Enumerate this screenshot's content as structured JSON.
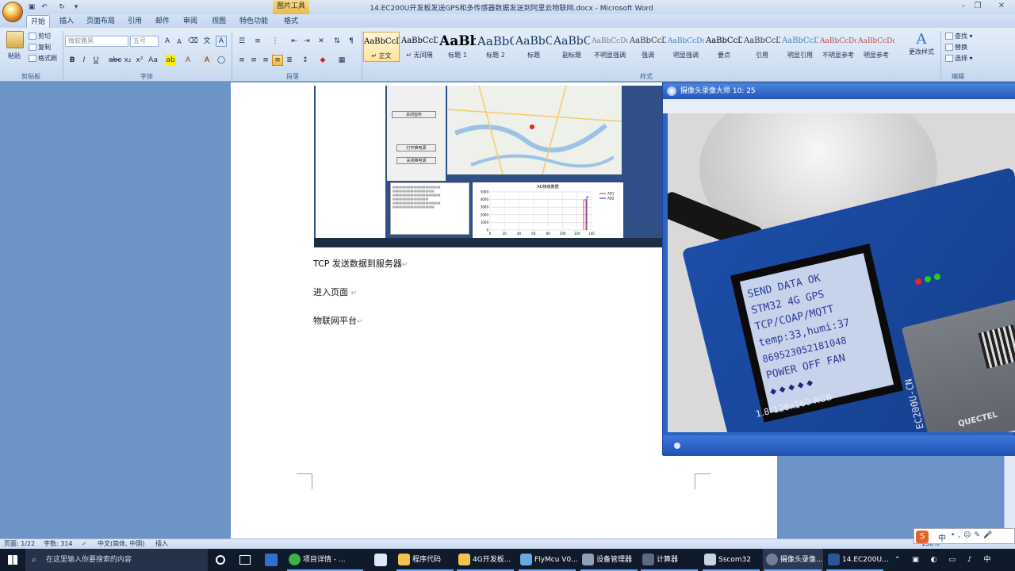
{
  "title_bar": {
    "contextual_tab": "图片工具",
    "window_title": "14.EC200U开发板发送GPS和多传感器数据发送到阿里云物联网.docx - Microsoft Word"
  },
  "tabs": [
    "开始",
    "插入",
    "页面布局",
    "引用",
    "邮件",
    "审阅",
    "视图",
    "特色功能",
    "格式"
  ],
  "ribbon": {
    "clipboard": {
      "paste": "粘贴",
      "cut": "剪切",
      "copy": "复制",
      "format_painter": "格式刷",
      "label": "剪贴板"
    },
    "font": {
      "name": "微软雅黑",
      "size": "五号",
      "label": "字体"
    },
    "paragraph": {
      "label": "段落"
    },
    "styles": {
      "label": "样式",
      "items": [
        {
          "preview": "AaBbCcDd",
          "name": "↵ 正文"
        },
        {
          "preview": "AaBbCcDd",
          "name": "↵ 无间隔"
        },
        {
          "preview": "AaBb",
          "name": "标题 1"
        },
        {
          "preview": "AaBbC",
          "name": "标题 2"
        },
        {
          "preview": "AaBbC",
          "name": "标题"
        },
        {
          "preview": "AaBbC",
          "name": "副标题"
        },
        {
          "preview": "AaBbCcDd",
          "name": "不明显强调"
        },
        {
          "preview": "AaBbCcDd",
          "name": "强调"
        },
        {
          "preview": "AaBbCcDd",
          "name": "明显强调"
        },
        {
          "preview": "AaBbCcDd",
          "name": "要点"
        },
        {
          "preview": "AaBbCcDd",
          "name": "引用"
        },
        {
          "preview": "AaBbCcDd",
          "name": "明显引用"
        },
        {
          "preview": "AaBbCcDd",
          "name": "不明显参考"
        },
        {
          "preview": "AaBbCcDd",
          "name": "明显参考"
        }
      ],
      "change_styles": "更改样式"
    },
    "editing": {
      "find": "查找",
      "replace": "替换",
      "select": "选择",
      "label": "编辑"
    }
  },
  "document": {
    "lines": [
      "TCP 发送数据到服务器",
      "进入页面",
      "物联网平台"
    ],
    "embedded": {
      "buttons": [
        "关闭监听",
        "打开推电源",
        "关闭推电源"
      ],
      "chart_title": "AD接收数据",
      "y_ticks": [
        "5000",
        "4000",
        "3000",
        "2000",
        "1000",
        "0"
      ],
      "x_ticks": [
        "0",
        "20",
        "40",
        "60",
        "80",
        "100",
        "120",
        "140"
      ],
      "legend": [
        "AD1",
        "AD2"
      ]
    }
  },
  "camera_window": {
    "title": "摄像头录像大师  10: 25",
    "lcd_lines": [
      "SEND DATA OK",
      "STM32 4G GPS",
      "TCP/COAP/MQTT",
      "temp:33,humi:37",
      "869523052181048",
      "POWER OFF FAN"
    ],
    "board_label": "1.8\"128x160 RGB",
    "module_label": "EC200U-CN",
    "brand": "QUECTEL"
  },
  "status_bar": {
    "page": "页面: 1/22",
    "words": "字数: 314",
    "language": "中文(简体, 中国)",
    "mode": "插入",
    "zoom": "130%"
  },
  "taskbar": {
    "search_placeholder": "在这里输入你要搜索的内容",
    "items": [
      "项目详情 - ...",
      "程序代码",
      "4G开发板...",
      "FlyMcu V0...",
      "设备管理器",
      "计算器",
      "Sscom32",
      "摄像头录像...",
      "14.EC200U..."
    ],
    "tray": "中"
  }
}
